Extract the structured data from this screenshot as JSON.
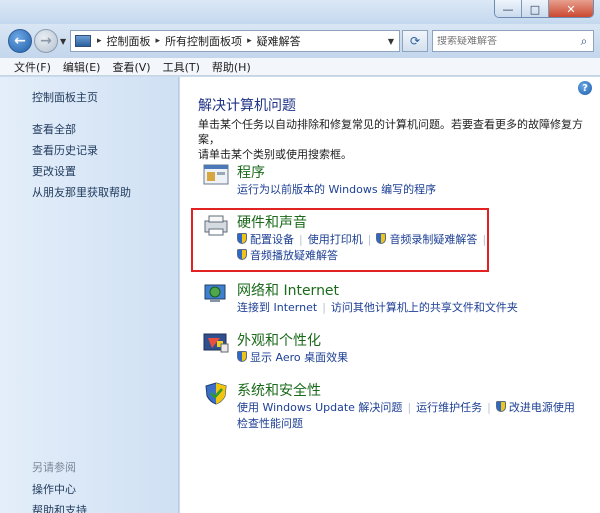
{
  "titlebar": {
    "min": "—",
    "max": "□",
    "close": "✕"
  },
  "nav": {
    "breadcrumbs": [
      "控制面板",
      "所有控制面板项",
      "疑难解答"
    ],
    "search_placeholder": "搜索疑难解答"
  },
  "menu": [
    "文件(F)",
    "编辑(E)",
    "查看(V)",
    "工具(T)",
    "帮助(H)"
  ],
  "sidebar": {
    "home": "控制面板主页",
    "links": [
      "查看全部",
      "查看历史记录",
      "更改设置",
      "从朋友那里获取帮助"
    ],
    "see_also": "另请参阅",
    "bottom_links": [
      "操作中心",
      "帮助和支持"
    ]
  },
  "main": {
    "title": "解决计算机问题",
    "desc_1": "单击某个任务以自动排除和修复常见的计算机问题。若要查看更多的故障修复方案，",
    "desc_2": "请单击某个类别或使用搜索框。",
    "categories": [
      {
        "title": "程序",
        "icon": "programs-icon",
        "links": [
          "运行为以前版本的 Windows 编写的程序"
        ]
      },
      {
        "title": "硬件和声音",
        "icon": "hardware-sound-icon",
        "links": [
          "配置设备",
          "使用打印机",
          "音频录制疑难解答",
          "音频播放疑难解答"
        ]
      },
      {
        "title": "网络和 Internet",
        "icon": "network-icon",
        "links": [
          "连接到 Internet",
          "访问其他计算机上的共享文件和文件夹"
        ]
      },
      {
        "title": "外观和个性化",
        "icon": "appearance-icon",
        "links": [
          "显示 Aero 桌面效果"
        ]
      },
      {
        "title": "系统和安全性",
        "icon": "security-icon",
        "links": [
          "使用 Windows Update 解决问题",
          "运行维护任务",
          "改进电源使用",
          "检查性能问题"
        ]
      }
    ]
  },
  "colors": {
    "category_title": "#1a6a1a",
    "link": "#1c3f94",
    "highlight": "#e02222"
  }
}
